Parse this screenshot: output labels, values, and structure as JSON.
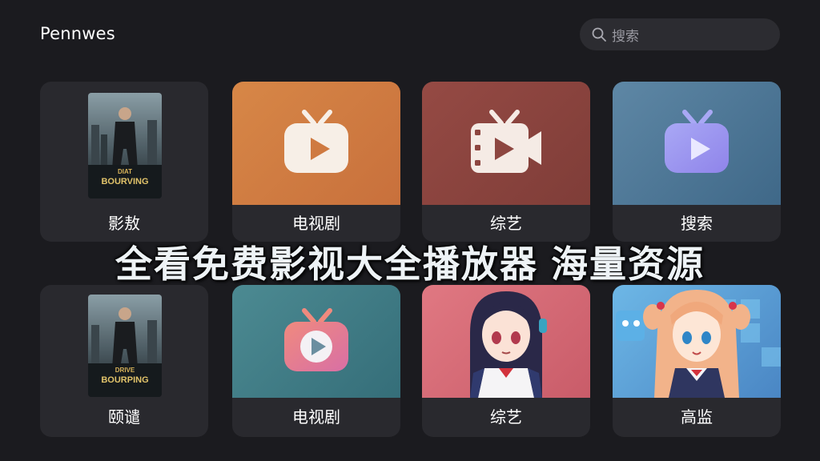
{
  "header": {
    "app_title": "Pennwes",
    "search": {
      "placeholder": "搜索",
      "icon": "search-icon"
    }
  },
  "banner": {
    "text_left": "全看免费影视大全播放器",
    "text_right": "海量资源"
  },
  "tiles": [
    {
      "label": "影敖",
      "poster_title": "BOURVING",
      "poster_top": "DIAT"
    },
    {
      "label": "电视剧",
      "icon": "tv-play-icon"
    },
    {
      "label": "综艺",
      "icon": "video-camera-icon"
    },
    {
      "label": "搜索",
      "icon": "tv-play-icon"
    },
    {
      "label": "颐谴",
      "poster_title": "BOURPING",
      "poster_top": "DRIVE"
    },
    {
      "label": "电视剧",
      "icon": "tv-play-icon"
    },
    {
      "label": "综艺",
      "icon": "anime-girl-image"
    },
    {
      "label": "高监",
      "icon": "anime-girl-image"
    }
  ],
  "colors": {
    "background": "#1b1b1f",
    "tile": "#29292e",
    "orange": "#d78747",
    "brown": "#954a44",
    "blue": "#5e87a5",
    "teal": "#4c8a92",
    "pink": "#e07882",
    "sky": "#6db7e6"
  }
}
